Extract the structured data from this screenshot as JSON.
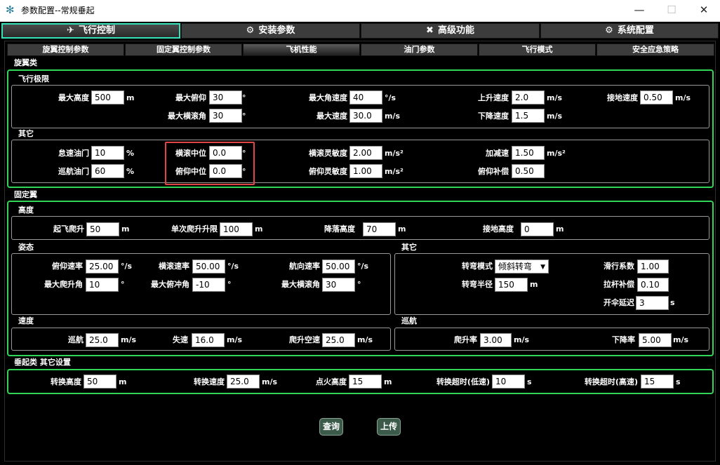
{
  "window": {
    "title": "参数配置--常规垂起",
    "app_icon": "gear-app-icon",
    "minimize": "—",
    "maximize": "☐",
    "close": "✕"
  },
  "main_tabs": [
    {
      "label": "飞行控制",
      "icon": "drone-icon",
      "glyph": "✈"
    },
    {
      "label": "安装参数",
      "icon": "wrench-circle-icon",
      "glyph": "⚙"
    },
    {
      "label": "高级功能",
      "icon": "tools-icon",
      "glyph": "✖"
    },
    {
      "label": "系统配置",
      "icon": "gear-icon",
      "glyph": "⚙"
    }
  ],
  "sub_tabs": [
    "旋翼控制参数",
    "固定翼控制参数",
    "飞机性能",
    "油门参数",
    "飞行模式",
    "安全应急策略"
  ],
  "sections": {
    "rotor": "旋翼类",
    "flight_limit": "飞行极限",
    "rotor_other": "其它",
    "fixed_wing": "固定翼",
    "altitude": "高度",
    "attitude": "姿态",
    "fw_other": "其它",
    "speed": "速度",
    "cruise": "巡航",
    "vtol_other": "垂起类 其它设置"
  },
  "flight_limit": {
    "max_alt": {
      "label": "最大高度",
      "value": "500",
      "unit": "m"
    },
    "max_pitch": {
      "label": "最大俯仰",
      "value": "30",
      "unit": "°"
    },
    "max_ang_speed": {
      "label": "最大角速度",
      "value": "40",
      "unit": "°/s"
    },
    "climb_speed": {
      "label": "上升速度",
      "value": "2.0",
      "unit": "m/s"
    },
    "land_speed": {
      "label": "接地速度",
      "value": "0.50",
      "unit": "m/s"
    },
    "max_roll": {
      "label": "最大横滚角",
      "value": "30",
      "unit": "°"
    },
    "max_speed": {
      "label": "最大速度",
      "value": "30.0",
      "unit": "m/s"
    },
    "descent_speed": {
      "label": "下降速度",
      "value": "1.5",
      "unit": "m/s"
    }
  },
  "rotor_other": {
    "idle_throttle": {
      "label": "怠速油门",
      "value": "10",
      "unit": "%"
    },
    "roll_neutral": {
      "label": "横滚中位",
      "value": "0.0",
      "unit": "°"
    },
    "roll_sens": {
      "label": "横滚灵敏度",
      "value": "2.00",
      "unit": "m/s²"
    },
    "accel_decel": {
      "label": "加减速",
      "value": "1.50",
      "unit": "m/s²"
    },
    "cruise_throttle": {
      "label": "巡航油门",
      "value": "60",
      "unit": "%"
    },
    "pitch_neutral": {
      "label": "俯仰中位",
      "value": "0.0",
      "unit": "°"
    },
    "pitch_sens": {
      "label": "俯仰灵敏度",
      "value": "1.00",
      "unit": "m/s²"
    },
    "pitch_comp": {
      "label": "俯仰补偿",
      "value": "0.50"
    }
  },
  "altitude": {
    "takeoff_climb": {
      "label": "起飞爬升",
      "value": "50",
      "unit": "m"
    },
    "single_climb": {
      "label": "单次爬升升限",
      "value": "100",
      "unit": "m"
    },
    "landing_alt": {
      "label": "降落高度",
      "value": "70",
      "unit": "m"
    },
    "ground_alt": {
      "label": "接地高度",
      "value": "0",
      "unit": "m"
    }
  },
  "attitude": {
    "pitch_rate": {
      "label": "俯仰速率",
      "value": "25.00",
      "unit": "°/s"
    },
    "roll_rate": {
      "label": "横滚速率",
      "value": "50.00",
      "unit": "°/s"
    },
    "yaw_rate": {
      "label": "航向速率",
      "value": "50.00",
      "unit": "°/s"
    },
    "max_climb_angle": {
      "label": "最大爬升角",
      "value": "10",
      "unit": "°"
    },
    "max_dive_angle": {
      "label": "最大俯冲角",
      "value": "-10",
      "unit": "°"
    },
    "max_roll_angle": {
      "label": "最大横滚角",
      "value": "30",
      "unit": "°"
    }
  },
  "fw_other": {
    "turn_mode": {
      "label": "转弯模式",
      "value": "倾斜转弯"
    },
    "glide": {
      "label": "滑行系数",
      "value": "1.00"
    },
    "turn_radius": {
      "label": "转弯半径",
      "value": "150",
      "unit": "m"
    },
    "stick_comp": {
      "label": "拉杆补偿",
      "value": "0.10"
    },
    "chute_delay": {
      "label": "开伞延迟",
      "value": "3",
      "unit": "s"
    }
  },
  "speed": {
    "cruise": {
      "label": "巡航",
      "value": "25.0",
      "unit": "m/s"
    },
    "stall": {
      "label": "失速",
      "value": "16.0",
      "unit": "m/s"
    },
    "climb_airspeed": {
      "label": "爬升空速",
      "value": "25.0",
      "unit": "m/s"
    }
  },
  "cruise": {
    "climb_rate": {
      "label": "爬升率",
      "value": "3.00",
      "unit": "m/s"
    },
    "descent_rate": {
      "label": "下降率",
      "value": "5.00",
      "unit": "m/s"
    }
  },
  "vtol_other": {
    "trans_alt": {
      "label": "转换高度",
      "value": "50",
      "unit": "m"
    },
    "trans_speed": {
      "label": "转换速度",
      "value": "25.0",
      "unit": "m/s"
    },
    "ignite_alt": {
      "label": "点火高度",
      "value": "15",
      "unit": "m"
    },
    "trans_timeout_low": {
      "label": "转换超时(低速)",
      "value": "10",
      "unit": "s"
    },
    "trans_timeout_high": {
      "label": "转换超时(高速)",
      "value": "15",
      "unit": "s"
    }
  },
  "buttons": {
    "query": "查询",
    "upload": "上传"
  },
  "colors": {
    "accent": "#35e1b9",
    "group_border": "#32d558",
    "highlight": "#e04545",
    "button": "#3b5a4a"
  }
}
